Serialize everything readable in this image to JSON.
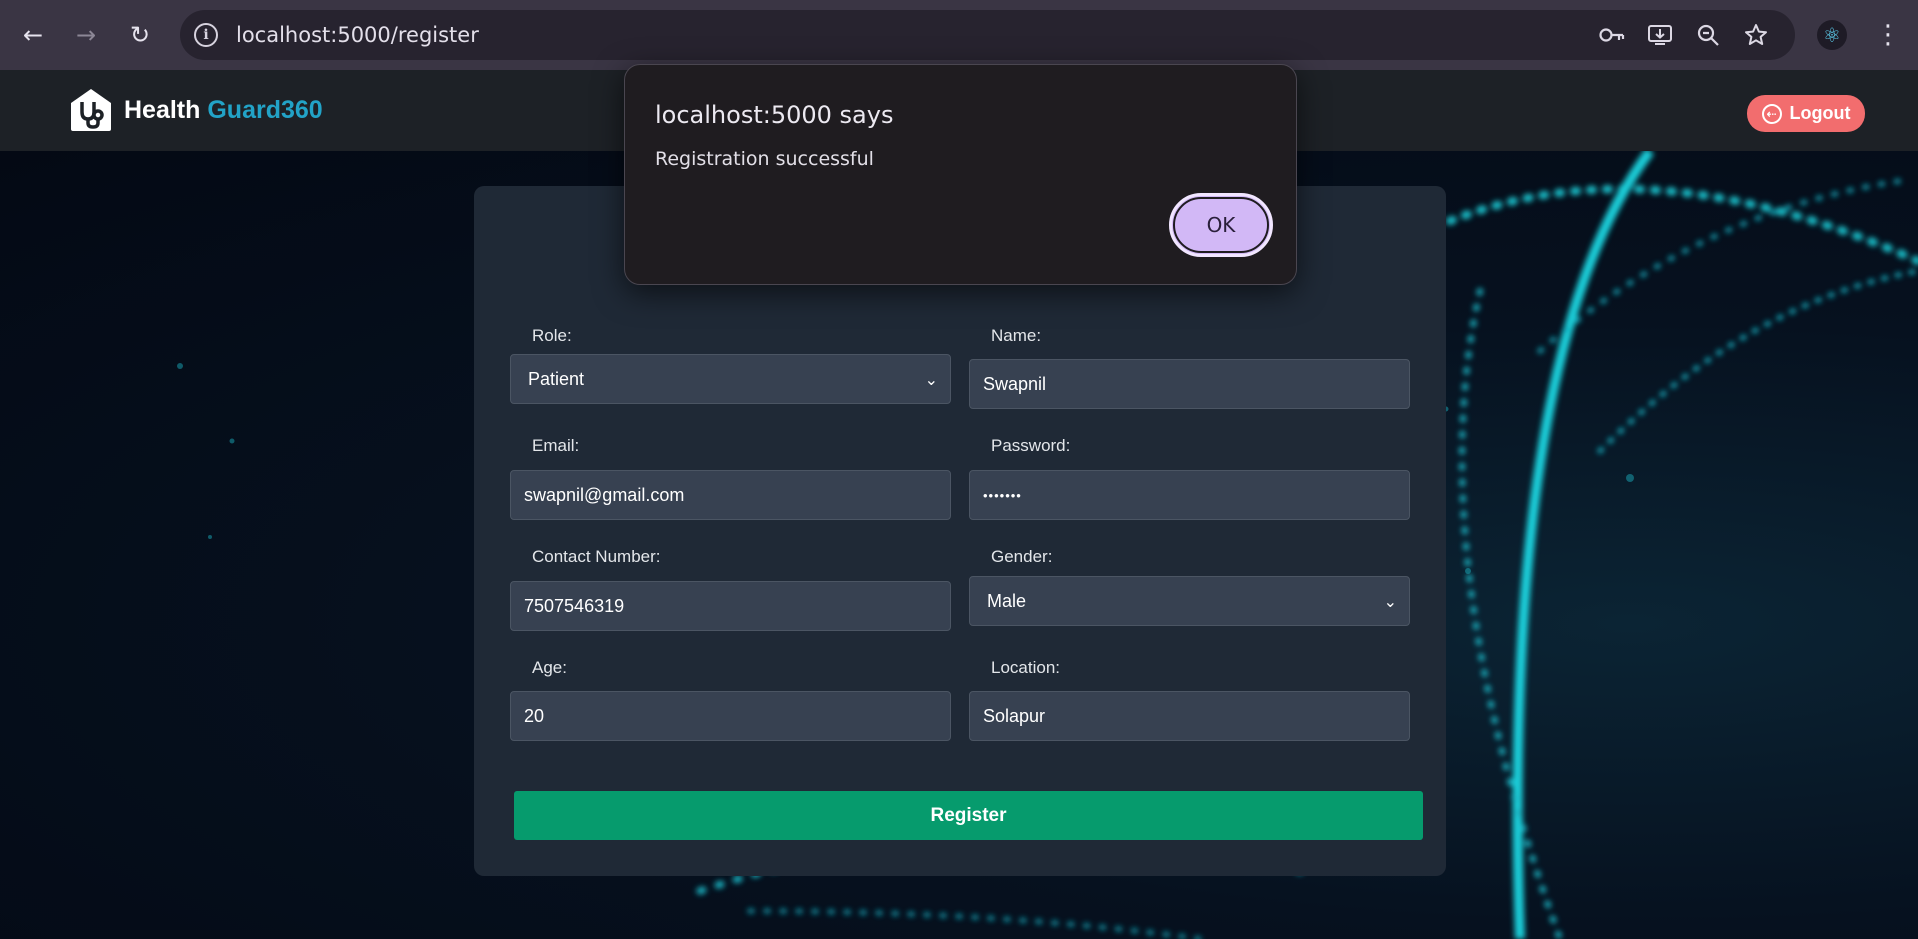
{
  "browser": {
    "url": "localhost:5000/register",
    "back_icon": "←",
    "forward_icon": "→",
    "reload_icon": "↻",
    "info_icon": "i",
    "menu_icon": "⋮"
  },
  "header": {
    "brand_part1": "Health",
    "brand_part2": "Guard360",
    "logout_label": "Logout",
    "colors": {
      "brand_accent": "#22a3c7",
      "logout_bg": "#f26d6e"
    }
  },
  "form": {
    "role_label": "Role:",
    "role_value": "Patient",
    "name_label": "Name:",
    "name_value": "Swapnil",
    "email_label": "Email:",
    "email_value": "swapnil@gmail.com",
    "password_label": "Password:",
    "password_value": "•••••••",
    "contact_label": "Contact Number:",
    "contact_value": "7507546319",
    "gender_label": "Gender:",
    "gender_value": "Male",
    "age_label": "Age:",
    "age_value": "20",
    "location_label": "Location:",
    "location_value": "Solapur",
    "register_label": "Register",
    "colors": {
      "register_bg": "#069b6d",
      "card_bg": "#1f2936",
      "field_bg": "#374151"
    }
  },
  "dialog": {
    "title": "localhost:5000 says",
    "message": "Registration successful",
    "ok_label": "OK"
  }
}
